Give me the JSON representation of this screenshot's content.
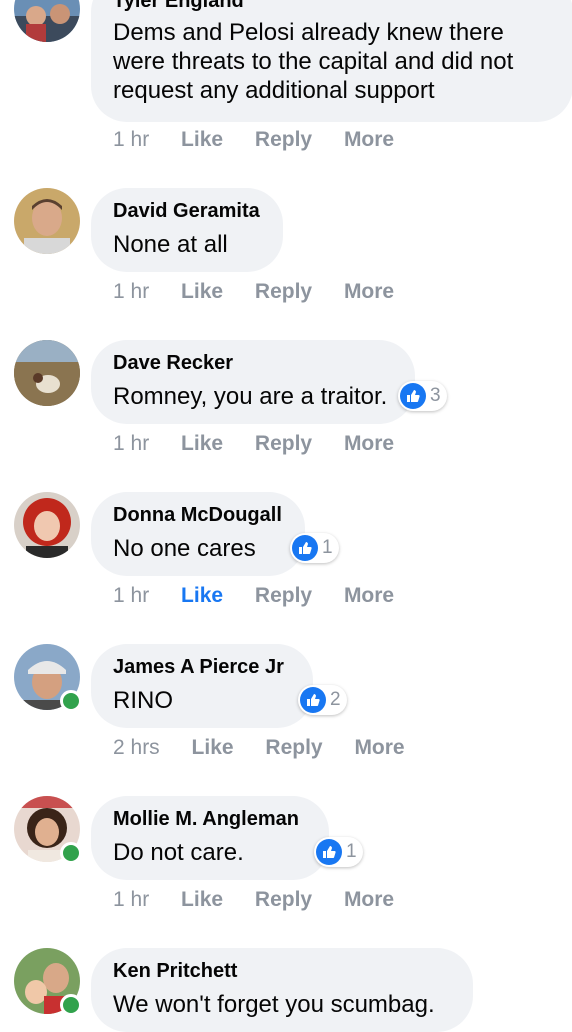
{
  "comments": [
    {
      "author": "Tyler England",
      "text_lines": [
        "Dems and Pelosi already knew there",
        "were threats to the capital and did not",
        "request any additional support"
      ],
      "time": "1 hr",
      "like": "Like",
      "reply": "Reply",
      "more": "More"
    },
    {
      "author": "David Geramita",
      "text": "None at all",
      "time": "1 hr",
      "like": "Like",
      "reply": "Reply",
      "more": "More"
    },
    {
      "author": "Dave Recker",
      "text": "Romney, you are a traitor.",
      "reactions": "3",
      "time": "1 hr",
      "like": "Like",
      "reply": "Reply",
      "more": "More"
    },
    {
      "author": "Donna McDougall",
      "text": "No one cares",
      "reactions": "1",
      "time": "1 hr",
      "like": "Like",
      "reply": "Reply",
      "more": "More",
      "liked_by_viewer": true
    },
    {
      "author": "James A Pierce Jr",
      "text": "RINO",
      "reactions": "2",
      "time": "2 hrs",
      "like": "Like",
      "reply": "Reply",
      "more": "More",
      "online": true
    },
    {
      "author": "Mollie M. Angleman",
      "text": "Do not care.",
      "reactions": "1",
      "time": "1 hr",
      "like": "Like",
      "reply": "Reply",
      "more": "More",
      "online": true
    },
    {
      "author": "Ken Pritchett",
      "text": "We won't forget you scumbag.",
      "online": true
    }
  ],
  "colors": {
    "bubble": "#f0f2f5",
    "action_gray": "#8d949e",
    "like_blue": "#1877f2",
    "online_green": "#31a24c"
  }
}
